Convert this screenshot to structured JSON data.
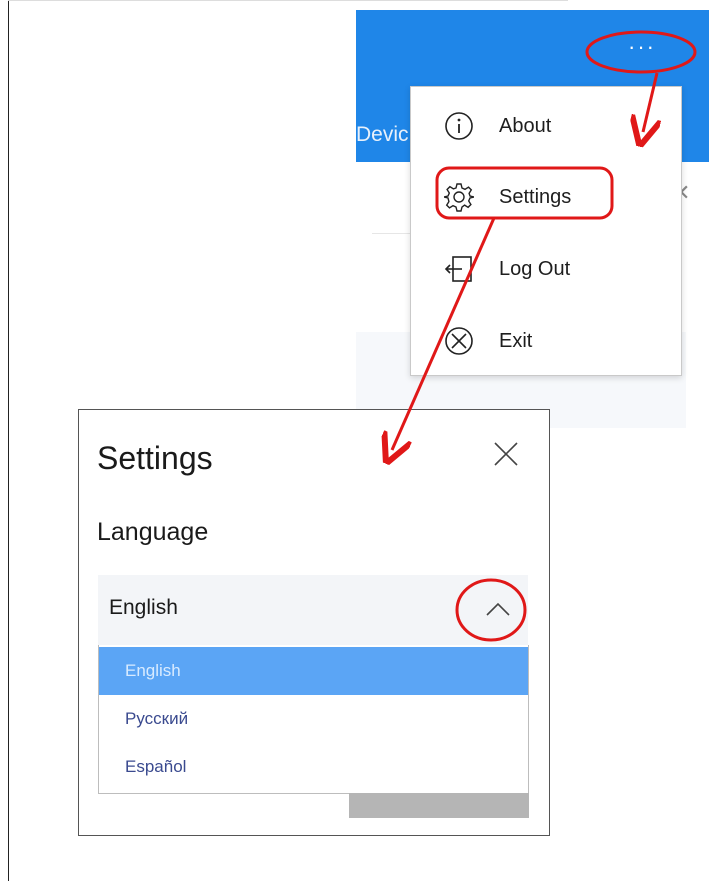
{
  "header": {
    "text": "Devic",
    "more_label": "···",
    "accent_color": "#1f86e8"
  },
  "menu": {
    "items": [
      {
        "label": "About",
        "icon": "info-icon"
      },
      {
        "label": "Settings",
        "icon": "gear-icon"
      },
      {
        "label": "Log Out",
        "icon": "logout-icon"
      },
      {
        "label": "Exit",
        "icon": "exit-circle-x-icon"
      }
    ]
  },
  "dialog": {
    "title": "Settings",
    "language_label": "Language",
    "selected_value": "English",
    "options": [
      {
        "label": "English",
        "selected": true
      },
      {
        "label": "Русский",
        "selected": false
      },
      {
        "label": "Español",
        "selected": false
      }
    ],
    "highlight_color": "#5ba5f5"
  },
  "annotation": {
    "color": "#e01818"
  }
}
